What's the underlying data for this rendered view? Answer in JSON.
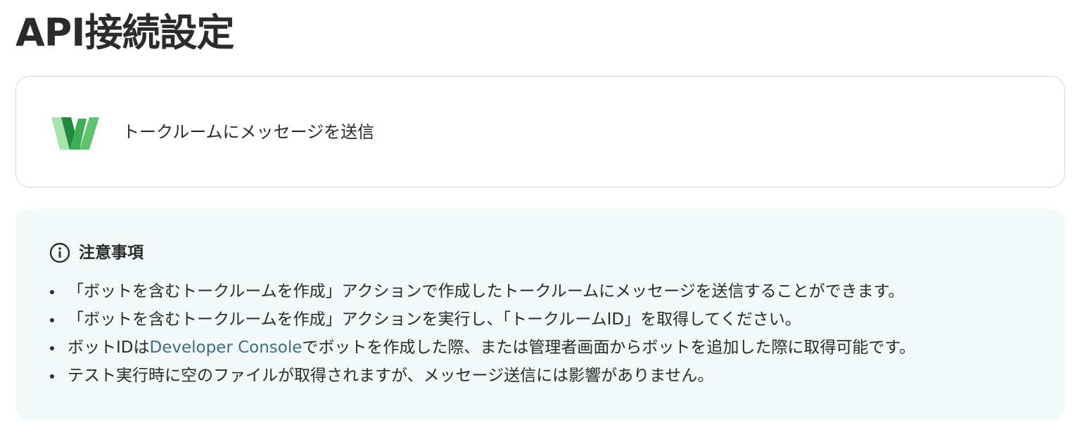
{
  "page": {
    "title": "API接続設定"
  },
  "action_card": {
    "label": "トークルームにメッセージを送信",
    "logo_icon": "line-works-logo",
    "logo_colors": [
      "#9be0a8",
      "#3fae55",
      "#1f8a3a"
    ]
  },
  "notice": {
    "icon": "info-circle-icon",
    "title": "注意事項",
    "items": [
      {
        "text": "「ボットを含むトークルームを作成」アクションで作成したトークルームにメッセージを送信することができます。"
      },
      {
        "text": "「ボットを含むトークルームを作成」アクションを実行し、「トークルームID」を取得してください。"
      },
      {
        "prefix": "ボットIDは",
        "link": "Developer Console",
        "suffix": "でボットを作成した際、または管理者画面からボットを追加した際に取得可能です。"
      },
      {
        "text": "テスト実行時に空のファイルが取得されますが、メッセージ送信には影響がありません。"
      }
    ]
  },
  "colors": {
    "link": "#3b6f86",
    "notice_background": "#f3f8f8",
    "card_border": "#d6d6d6"
  }
}
